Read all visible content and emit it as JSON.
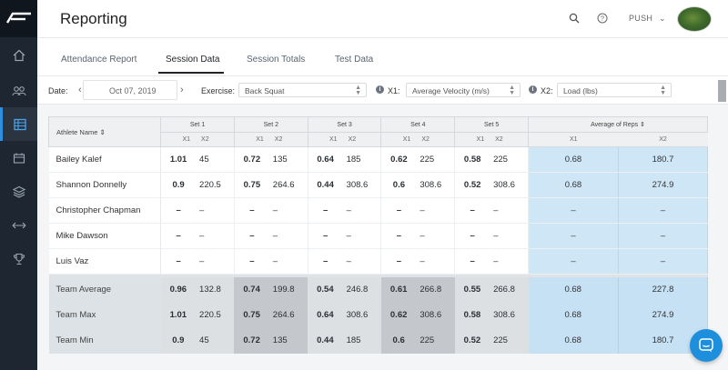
{
  "header": {
    "title": "Reporting",
    "user_menu_label": "PUSH"
  },
  "tabs": [
    {
      "label": "Attendance Report",
      "active": false
    },
    {
      "label": "Session Data",
      "active": true
    },
    {
      "label": "Session Totals",
      "active": false
    },
    {
      "label": "Test Data",
      "active": false
    }
  ],
  "filters": {
    "date_label": "Date:",
    "date_value": "Oct 07, 2019",
    "exercise_label": "Exercise:",
    "exercise_value": "Back Squat",
    "x1_label": "X1:",
    "x1_value": "Average Velocity (m/s)",
    "x2_label": "X2:",
    "x2_value": "Load (lbs)"
  },
  "table": {
    "athlete_header": "Athlete Name",
    "sort_icon": "sort-icon",
    "set_headers": [
      "Set 1",
      "Set 2",
      "Set 3",
      "Set 4",
      "Set 5"
    ],
    "avg_header": "Average of Reps",
    "x1_sub": "X1",
    "x2_sub": "X2",
    "rows": [
      {
        "name": "Bailey Kalef",
        "sets": [
          [
            "1.01",
            "45"
          ],
          [
            "0.72",
            "135"
          ],
          [
            "0.64",
            "185"
          ],
          [
            "0.62",
            "225"
          ],
          [
            "0.58",
            "225"
          ]
        ],
        "avg": [
          "0.68",
          "180.7"
        ]
      },
      {
        "name": "Shannon Donnelly",
        "sets": [
          [
            "0.9",
            "220.5"
          ],
          [
            "0.75",
            "264.6"
          ],
          [
            "0.44",
            "308.6"
          ],
          [
            "0.6",
            "308.6"
          ],
          [
            "0.52",
            "308.6"
          ]
        ],
        "avg": [
          "0.68",
          "274.9"
        ]
      },
      {
        "name": "Christopher Chapman",
        "sets": [
          [
            "–",
            "–"
          ],
          [
            "–",
            "–"
          ],
          [
            "–",
            "–"
          ],
          [
            "–",
            "–"
          ],
          [
            "–",
            "–"
          ]
        ],
        "avg": [
          "–",
          "–"
        ]
      },
      {
        "name": "Mike Dawson",
        "sets": [
          [
            "–",
            "–"
          ],
          [
            "–",
            "–"
          ],
          [
            "–",
            "–"
          ],
          [
            "–",
            "–"
          ],
          [
            "–",
            "–"
          ]
        ],
        "avg": [
          "–",
          "–"
        ]
      },
      {
        "name": "Luis Vaz",
        "sets": [
          [
            "–",
            "–"
          ],
          [
            "–",
            "–"
          ],
          [
            "–",
            "–"
          ],
          [
            "–",
            "–"
          ],
          [
            "–",
            "–"
          ]
        ],
        "avg": [
          "–",
          "–"
        ]
      }
    ],
    "team_rows": [
      {
        "name": "Team Average",
        "sets": [
          [
            "0.96",
            "132.8"
          ],
          [
            "0.74",
            "199.8"
          ],
          [
            "0.54",
            "246.8"
          ],
          [
            "0.61",
            "266.8"
          ],
          [
            "0.55",
            "266.8"
          ]
        ],
        "avg": [
          "0.68",
          "227.8"
        ]
      },
      {
        "name": "Team Max",
        "sets": [
          [
            "1.01",
            "220.5"
          ],
          [
            "0.75",
            "264.6"
          ],
          [
            "0.64",
            "308.6"
          ],
          [
            "0.62",
            "308.6"
          ],
          [
            "0.58",
            "308.6"
          ]
        ],
        "avg": [
          "0.68",
          "274.9"
        ]
      },
      {
        "name": "Team Min",
        "sets": [
          [
            "0.9",
            "45"
          ],
          [
            "0.72",
            "135"
          ],
          [
            "0.44",
            "185"
          ],
          [
            "0.6",
            "225"
          ],
          [
            "0.52",
            "225"
          ]
        ],
        "avg": [
          "0.68",
          "180.7"
        ]
      }
    ]
  },
  "colors": {
    "sidebar": "#1d2631",
    "accent": "#2f8fde",
    "avg_column": "#cfe6f7",
    "chat_button": "#1e8fdc"
  }
}
